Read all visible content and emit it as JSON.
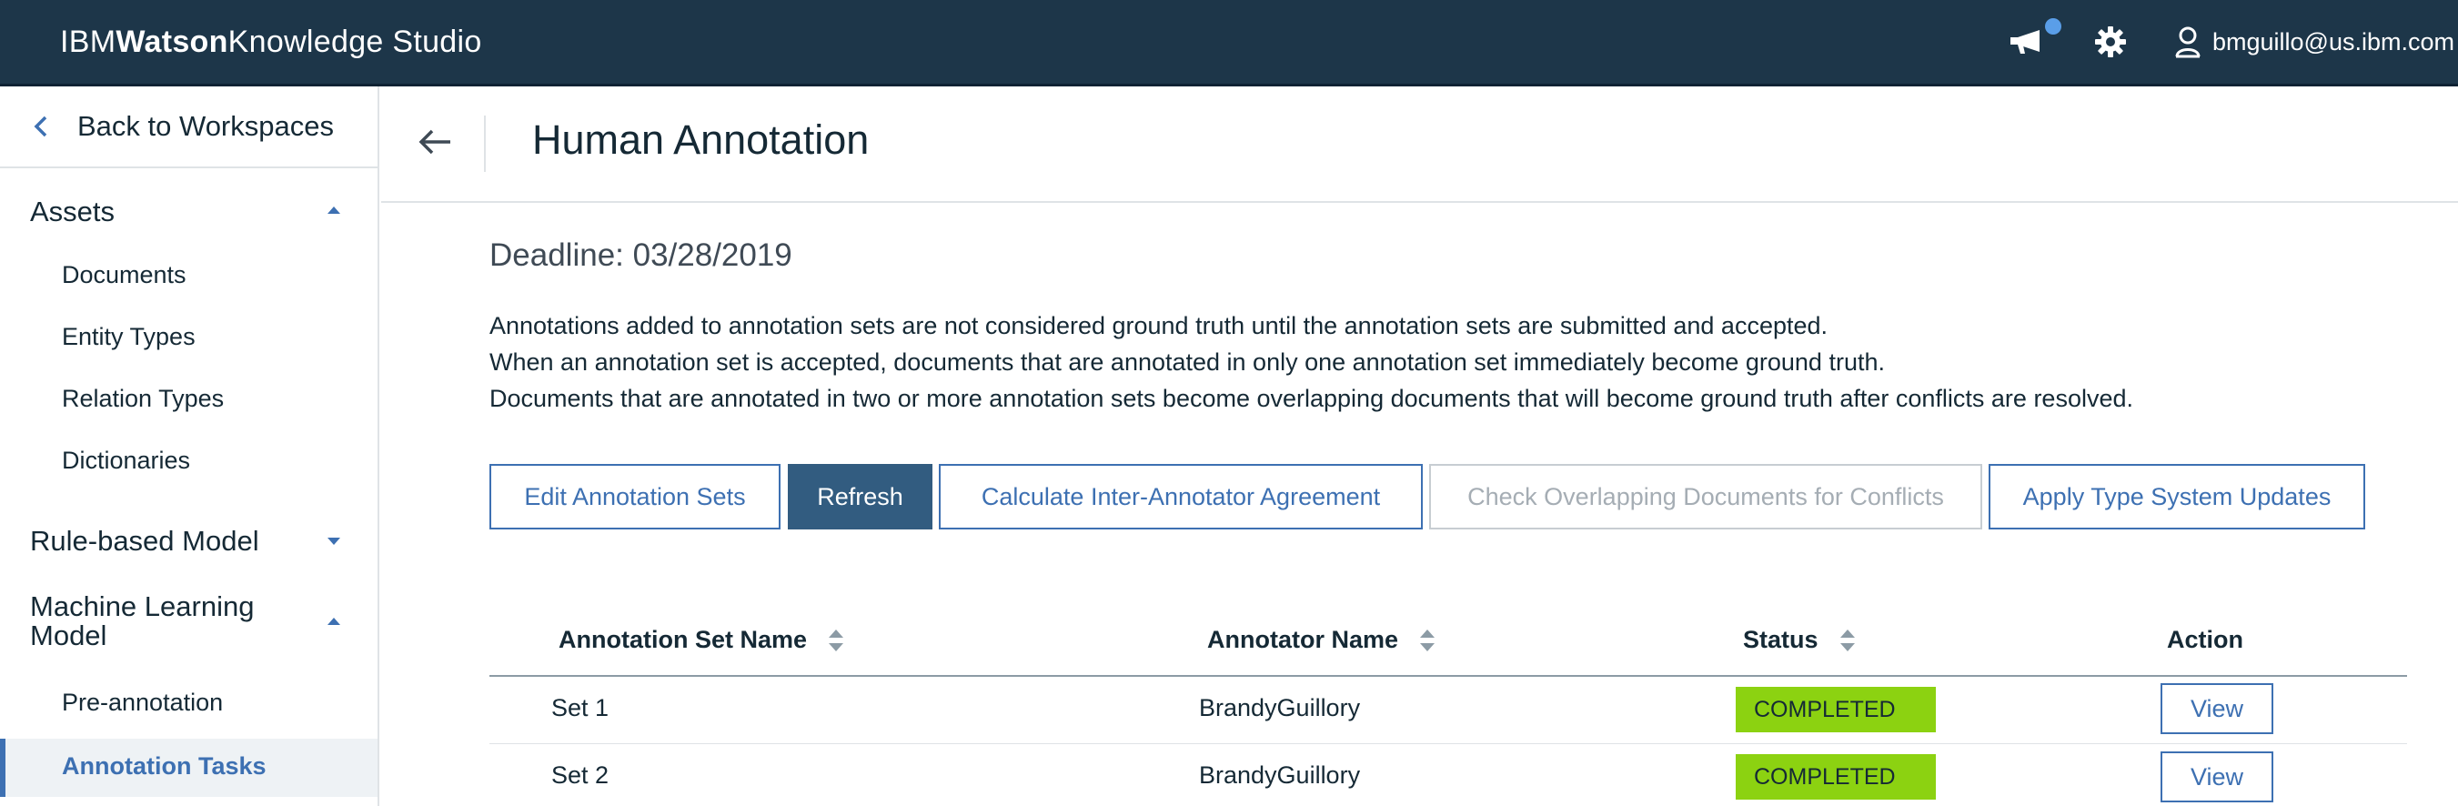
{
  "header": {
    "brand_prefix": "IBM",
    "brand_bold": "Watson",
    "brand_suffix": "Knowledge Studio",
    "user_email": "bmguillo@us.ibm.com"
  },
  "sidebar": {
    "back_label": "Back to Workspaces",
    "sections": [
      {
        "label": "Assets",
        "expanded": true,
        "items": [
          "Documents",
          "Entity Types",
          "Relation Types",
          "Dictionaries"
        ]
      },
      {
        "label": "Rule-based Model",
        "expanded": false,
        "items": []
      },
      {
        "label_line1": "Machine Learning",
        "label_line2": "Model",
        "expanded": true,
        "items": [
          "Pre-annotation",
          "Annotation Tasks"
        ]
      }
    ],
    "active_item": "Annotation Tasks"
  },
  "main": {
    "title": "Human Annotation",
    "deadline": "Deadline: 03/28/2019",
    "description": [
      "Annotations added to annotation sets are not considered ground truth until the annotation sets are submitted and accepted.",
      "When an annotation set is accepted, documents that are annotated in only one annotation set immediately become ground truth.",
      "Documents that are annotated in two or more annotation sets become overlapping documents that will become ground truth after conflicts are resolved."
    ],
    "buttons": {
      "edit_sets": "Edit Annotation Sets",
      "refresh": "Refresh",
      "calc_iaa": "Calculate Inter-Annotator Agreement",
      "check_overlap": "Check Overlapping Documents for Conflicts",
      "apply_updates": "Apply Type System Updates"
    },
    "table": {
      "columns": [
        "Annotation Set Name",
        "Annotator Name",
        "Status",
        "Action"
      ],
      "rows": [
        {
          "set_name": "Set 1",
          "annotator": "BrandyGuillory",
          "status": "COMPLETED",
          "action": "View"
        },
        {
          "set_name": "Set 2",
          "annotator": "BrandyGuillory",
          "status": "COMPLETED",
          "action": "View"
        }
      ]
    }
  },
  "colors": {
    "header_bg": "#1d3649",
    "accent_blue": "#3d70b2",
    "primary_button": "#325c80",
    "status_completed": "#8cd211",
    "notification_dot": "#5a9ee8"
  },
  "icons": [
    "megaphone-icon",
    "gear-icon",
    "user-icon",
    "chevron-left-icon",
    "caret-up-icon",
    "caret-down-icon",
    "arrow-left-icon",
    "sort-icon"
  ]
}
